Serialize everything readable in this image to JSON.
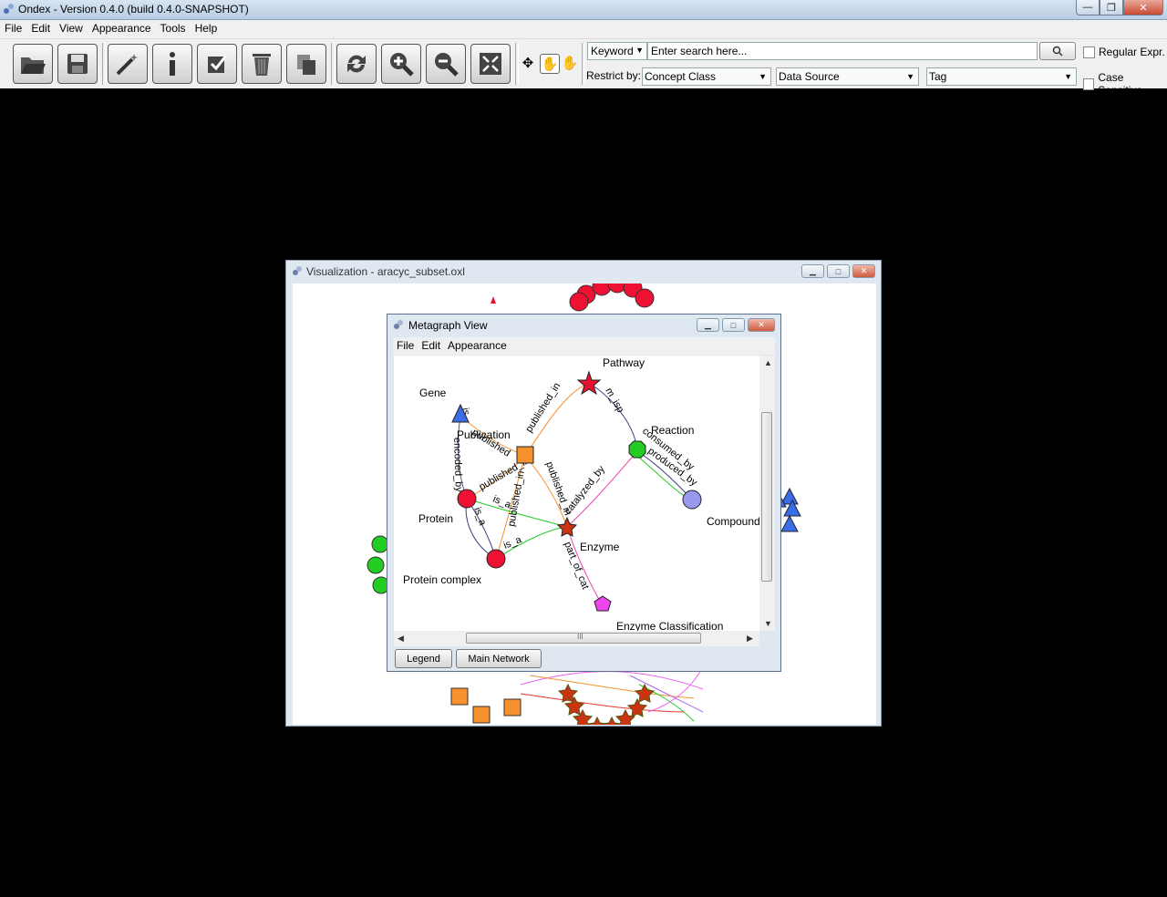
{
  "app": {
    "title": "Ondex - Version 0.4.0 (build  0.4.0-SNAPSHOT)",
    "window_controls": {
      "minimize": "—",
      "maximize": "❐",
      "close": "✕"
    }
  },
  "menubar": {
    "items": [
      {
        "label": "File"
      },
      {
        "label": "Edit"
      },
      {
        "label": "View"
      },
      {
        "label": "Appearance"
      },
      {
        "label": "Tools"
      },
      {
        "label": "Help"
      }
    ]
  },
  "toolbar": {
    "buttons": [
      {
        "icon": "open-folder-icon"
      },
      {
        "icon": "save-disk-icon"
      },
      {
        "icon": "magic-wand-icon"
      },
      {
        "icon": "info-icon"
      },
      {
        "icon": "checkbox-icon"
      },
      {
        "icon": "trash-icon"
      },
      {
        "icon": "copy-icon"
      },
      {
        "icon": "refresh-icon"
      },
      {
        "icon": "zoom-in-icon"
      },
      {
        "icon": "zoom-out-icon"
      },
      {
        "icon": "fit-screen-icon"
      }
    ],
    "tools": [
      {
        "icon": "move-icon",
        "glyph": "✥"
      },
      {
        "icon": "select-hand-icon",
        "glyph": "✋"
      },
      {
        "icon": "pan-hand-icon",
        "glyph": "✋"
      }
    ]
  },
  "search": {
    "mode_value": "Keyword",
    "placeholder": "Enter search here...",
    "button_icon": "search-icon",
    "regular_expr_label": "Regular Expr.",
    "regular_expr_checked": false,
    "case_sensitive_label": "Case Sensitive",
    "case_sensitive_checked": false,
    "restrict_label": "Restrict by:",
    "concept_class_value": "Concept Class",
    "data_source_value": "Data Source",
    "tag_value": "Tag"
  },
  "visualization_window": {
    "title": "Visualization - aracyc_subset.oxl"
  },
  "metagraph_window": {
    "title": "Metagraph View",
    "menu": [
      {
        "label": "File"
      },
      {
        "label": "Edit"
      },
      {
        "label": "Appearance"
      }
    ],
    "nodes": [
      {
        "id": "pathway",
        "label": "Pathway",
        "shape": "star",
        "color": "#e8112d"
      },
      {
        "id": "gene",
        "label": "Gene",
        "shape": "triangle",
        "color": "#3a6ee8"
      },
      {
        "id": "publication",
        "label": "Publication",
        "shape": "square",
        "color": "#f5922e"
      },
      {
        "id": "reaction",
        "label": "Reaction",
        "shape": "octagon",
        "color": "#22cc22"
      },
      {
        "id": "compound",
        "label": "Compound",
        "shape": "circle",
        "color": "#9999ee"
      },
      {
        "id": "protein",
        "label": "Protein",
        "shape": "circle",
        "color": "#ee1133"
      },
      {
        "id": "enzyme",
        "label": "Enzyme",
        "shape": "star",
        "color": "#cc3311"
      },
      {
        "id": "protein_complex",
        "label": "Protein complex",
        "shape": "circle",
        "color": "#ee1133"
      },
      {
        "id": "enzyme_classification",
        "label": "Enzyme Classification",
        "shape": "pentagon",
        "color": "#ee44ee"
      }
    ],
    "edge_labels": [
      "is",
      "encoded_by",
      "published",
      "published_in",
      "published_in",
      "published_in",
      "m_isp",
      "consumed_by",
      "produced_by",
      "catalyzed_by",
      "published_in",
      "is_a",
      "is_a",
      "is_a",
      "part_of_cat"
    ],
    "buttons": {
      "legend": "Legend",
      "main_network": "Main Network"
    },
    "scroll_grip": "III"
  }
}
